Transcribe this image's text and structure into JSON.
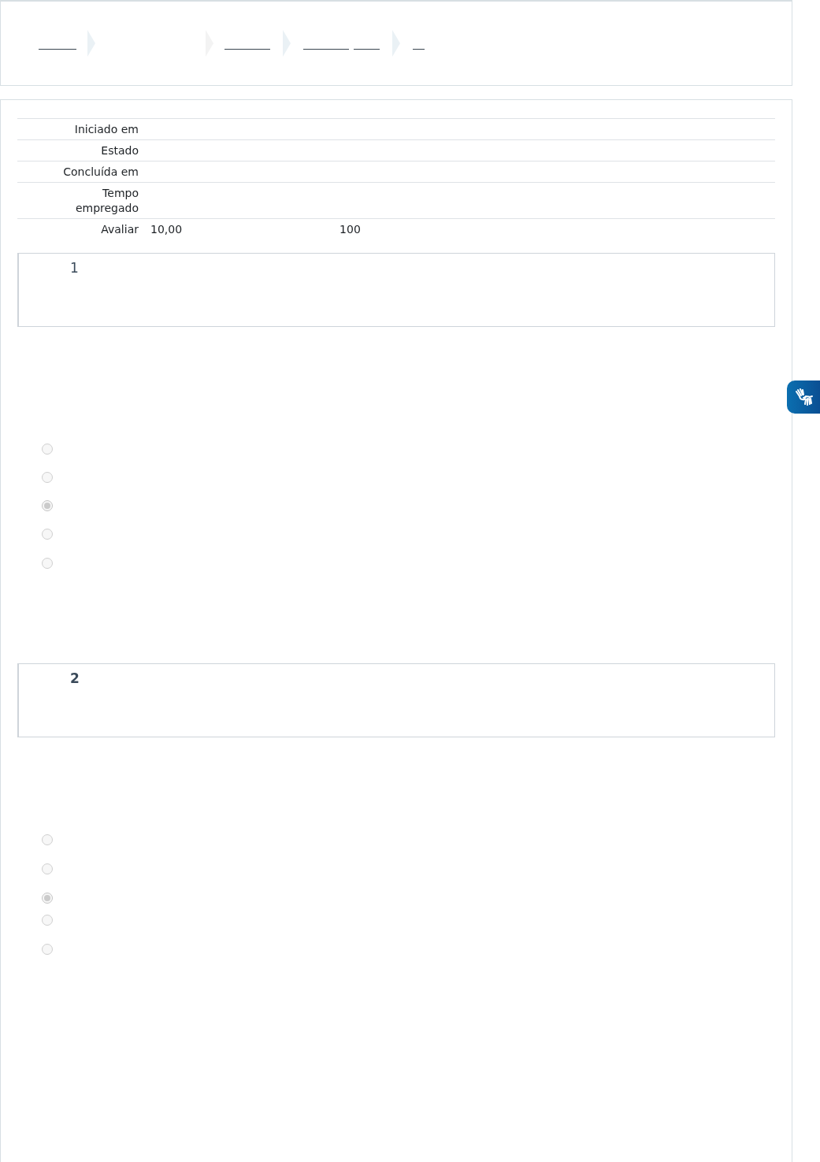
{
  "summary": {
    "rows": [
      {
        "label": "Iniciado em"
      },
      {
        "label": "Estado"
      },
      {
        "label": "Concluída em"
      },
      {
        "label": "Tempo empregado"
      },
      {
        "label": "Avaliar",
        "value": "10,00",
        "extra": "100"
      }
    ]
  },
  "questions": [
    {
      "number": "1",
      "options": [
        {
          "selected": false
        },
        {
          "selected": false
        },
        {
          "selected": true
        },
        {
          "selected": false
        },
        {
          "selected": false
        }
      ]
    },
    {
      "number": "2",
      "options": [
        {
          "selected": false
        },
        {
          "selected": false
        },
        {
          "selected": true
        },
        {
          "selected": false
        },
        {
          "selected": false
        }
      ]
    }
  ]
}
